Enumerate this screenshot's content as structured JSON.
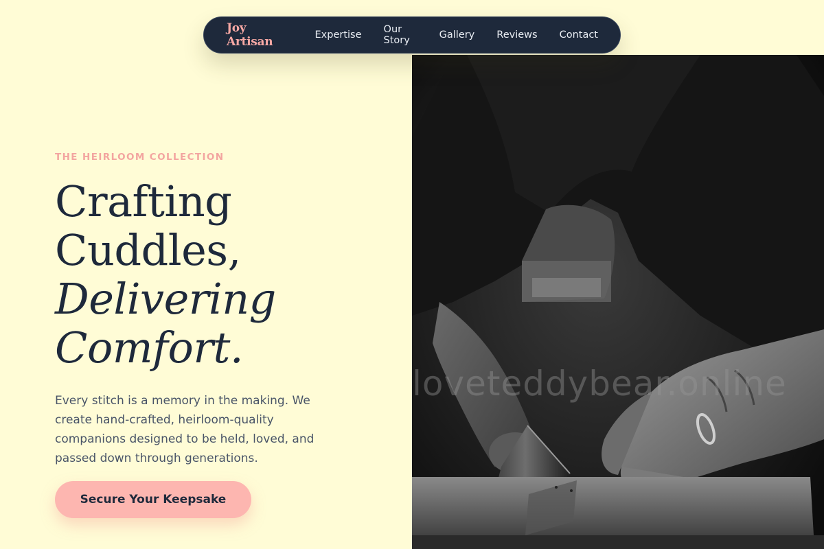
{
  "nav": {
    "brand": "Joy Artisan",
    "links": [
      "Expertise",
      "Our Story",
      "Gallery",
      "Reviews",
      "Contact"
    ]
  },
  "hero": {
    "eyebrow": "THE HEIRLOOM COLLECTION",
    "headline": {
      "line1": "Crafting",
      "line2": "Cuddles,",
      "line3": "Delivering",
      "line4": "Comfort."
    },
    "description": "Every stitch is a memory in the making. We create hand-crafted, heirloom-quality companions designed to be held, loved, and passed down through generations.",
    "cta_label": "Secure Your Keepsake"
  },
  "photo": {
    "watermark": "loveteddybear.online",
    "subject": "black-and-white photo of a craftsman's hands sawing a wooden block"
  },
  "colors": {
    "background": "#fffcd6",
    "nav_background": "#1e293b",
    "brand_pink": "#f7a8a4",
    "heading": "#1e293b",
    "cta_background": "#fdb6b0"
  }
}
